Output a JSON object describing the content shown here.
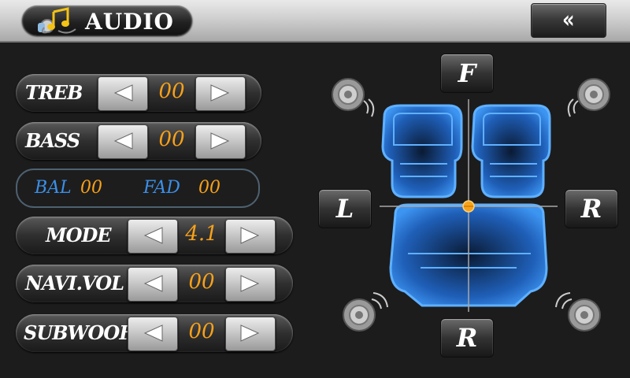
{
  "header": {
    "title": "AUDIO",
    "back_glyph": "«",
    "icon": "music-note-icon"
  },
  "controls": [
    {
      "label": "TREB",
      "value": "00"
    },
    {
      "label": "BASS",
      "value": "00"
    },
    {
      "label": "MODE",
      "value": "4.1"
    },
    {
      "label": "NAVI.VOL",
      "value": "00"
    },
    {
      "label": "SUBWOOF",
      "value": "00"
    }
  ],
  "balance_fader": {
    "bal_label": "BAL",
    "bal_value": "00",
    "fad_label": "FAD",
    "fad_value": "00"
  },
  "directions": {
    "front": "F",
    "left": "L",
    "right": "R",
    "rear": "R"
  },
  "colors": {
    "value_orange": "#f7a11a",
    "label_blue": "#3b8fe8",
    "seat_blue": "#2f86e8"
  }
}
